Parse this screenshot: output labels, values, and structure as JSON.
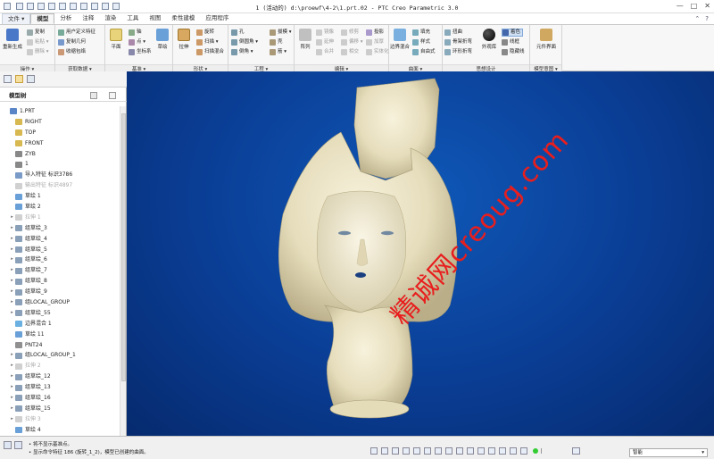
{
  "window": {
    "title": "1 (活动的) d:\\proewf\\4-2\\1.prt.02 - PTC Creo Parametric 3.0",
    "minimize": "—",
    "maximize": "□",
    "close": "✕"
  },
  "menu_tabs": [
    {
      "label": "文件 ▾",
      "active": false
    },
    {
      "label": "模型",
      "active": true
    },
    {
      "label": "分析",
      "active": false
    },
    {
      "label": "注释",
      "active": false
    },
    {
      "label": "渲染",
      "active": false
    },
    {
      "label": "工具",
      "active": false
    },
    {
      "label": "视图",
      "active": false
    },
    {
      "label": "柔性建模",
      "active": false
    },
    {
      "label": "应用程序",
      "active": false
    }
  ],
  "ribbon": {
    "operations": {
      "label": "操作 ▾",
      "regenerate": "重新生成",
      "copy": "复制",
      "paste": "粘贴 ▾",
      "delete": "删除 ▾"
    },
    "get_data": {
      "label": "获取数据 ▾",
      "udf": "用户定义特征",
      "copy_geom": "复制几何",
      "shrinkwrap": "收缩包络"
    },
    "datum": {
      "label": "基准 ▾",
      "plane": "平面",
      "axis": "轴",
      "point": "点 ▾",
      "csys": "坐标系",
      "sketch": "草绘"
    },
    "shapes": {
      "label": "形状 ▾",
      "extrude": "拉伸",
      "revolve": "旋转",
      "sweep": "扫描 ▾",
      "swept_blend": "扫描混合"
    },
    "engineering": {
      "label": "工程 ▾",
      "hole": "孔",
      "round": "倒圆角 ▾",
      "chamfer": "倒角 ▾",
      "draft": "拔模 ▾",
      "shell": "壳",
      "rib": "筋 ▾"
    },
    "editing": {
      "label": "编辑 ▾",
      "pattern": "阵列",
      "mirror": "镜像",
      "extend": "延伸",
      "trim": "修剪",
      "offset": "偏移 ▾",
      "merge": "合并",
      "intersect": "相交",
      "project": "投影",
      "thicken": "加厚",
      "solidify": "实体化"
    },
    "surfaces": {
      "label": "曲面 ▾",
      "boundary_blend": "边界混合",
      "fill": "填充",
      "style": "样式",
      "freestyle": "自由式"
    },
    "model_intent": {
      "label": "模型意图 ▾",
      "component_interface": "元件界面"
    },
    "design": {
      "label": "思想设计",
      "warp": "扭曲",
      "spinal_bend": "骨架折弯",
      "toroidal_bend": "环形折弯",
      "appearance": "外观库",
      "shading": "着色",
      "wireframe": "线框",
      "hidden_line": "隐藏线"
    }
  },
  "model_tree": {
    "header": "模型树",
    "items": [
      {
        "label": "1.PRT",
        "indent": 0,
        "expand": "",
        "icon": "part-icon",
        "dim": false
      },
      {
        "label": "RIGHT",
        "indent": 1,
        "expand": "",
        "icon": "datum-plane-icon",
        "dim": false
      },
      {
        "label": "TOP",
        "indent": 1,
        "expand": "",
        "icon": "datum-plane-icon",
        "dim": false
      },
      {
        "label": "FRONT",
        "indent": 1,
        "expand": "",
        "icon": "datum-plane-icon",
        "dim": false
      },
      {
        "label": "ZYB",
        "indent": 1,
        "expand": "",
        "icon": "csys-icon",
        "dim": false
      },
      {
        "label": "1",
        "indent": 1,
        "expand": "",
        "icon": "csys-icon",
        "dim": false
      },
      {
        "label": "导入特征 标识3786",
        "indent": 1,
        "expand": "",
        "icon": "import-icon",
        "dim": false
      },
      {
        "label": "输出特征 标识4897",
        "indent": 1,
        "expand": "",
        "icon": "import-icon",
        "dim": true
      },
      {
        "label": "草绘 1",
        "indent": 1,
        "expand": "",
        "icon": "sketch-icon",
        "dim": false
      },
      {
        "label": "草绘 2",
        "indent": 1,
        "expand": "",
        "icon": "sketch-icon",
        "dim": false
      },
      {
        "label": "拉伸 1",
        "indent": 1,
        "expand": "▸",
        "icon": "extrude-icon",
        "dim": true
      },
      {
        "label": "组草绘_3",
        "indent": 1,
        "expand": "▸",
        "icon": "group-icon",
        "dim": false
      },
      {
        "label": "组草绘_4",
        "indent": 1,
        "expand": "▸",
        "icon": "group-icon",
        "dim": false
      },
      {
        "label": "组草绘_5",
        "indent": 1,
        "expand": "▸",
        "icon": "group-icon",
        "dim": false
      },
      {
        "label": "组草绘_6",
        "indent": 1,
        "expand": "▸",
        "icon": "group-icon",
        "dim": false
      },
      {
        "label": "组草绘_7",
        "indent": 1,
        "expand": "▸",
        "icon": "group-icon",
        "dim": false
      },
      {
        "label": "组草绘_8",
        "indent": 1,
        "expand": "▸",
        "icon": "group-icon",
        "dim": false
      },
      {
        "label": "组草绘_9",
        "indent": 1,
        "expand": "▸",
        "icon": "group-icon",
        "dim": false
      },
      {
        "label": "组LOCAL_GROUP",
        "indent": 1,
        "expand": "▸",
        "icon": "group-icon",
        "dim": false
      },
      {
        "label": "组草绘_55",
        "indent": 1,
        "expand": "▸",
        "icon": "group-icon",
        "dim": false
      },
      {
        "label": "边界混合 1",
        "indent": 1,
        "expand": "",
        "icon": "boundary-blend-icon",
        "dim": false
      },
      {
        "label": "草绘 11",
        "indent": 1,
        "expand": "",
        "icon": "sketch-icon",
        "dim": false
      },
      {
        "label": "PNT24",
        "indent": 1,
        "expand": "",
        "icon": "datum-point-icon",
        "dim": false
      },
      {
        "label": "组LOCAL_GROUP_1",
        "indent": 1,
        "expand": "▸",
        "icon": "group-icon",
        "dim": false
      },
      {
        "label": "拉伸 2",
        "indent": 1,
        "expand": "▸",
        "icon": "extrude-icon",
        "dim": true
      },
      {
        "label": "组草绘_12",
        "indent": 1,
        "expand": "▸",
        "icon": "group-icon",
        "dim": false
      },
      {
        "label": "组草绘_13",
        "indent": 1,
        "expand": "▸",
        "icon": "group-icon",
        "dim": false
      },
      {
        "label": "组草绘_16",
        "indent": 1,
        "expand": "▸",
        "icon": "group-icon",
        "dim": false
      },
      {
        "label": "组草绘_15",
        "indent": 1,
        "expand": "▸",
        "icon": "group-icon",
        "dim": false
      },
      {
        "label": "拉伸 3",
        "indent": 1,
        "expand": "▸",
        "icon": "extrude-icon",
        "dim": true
      },
      {
        "label": "草绘 4",
        "indent": 1,
        "expand": "",
        "icon": "sketch-icon",
        "dim": false
      }
    ]
  },
  "viewport": {
    "watermark": "精诚网creoug.com",
    "background_color": "#0a3d94",
    "model_color": "#ece5c6"
  },
  "status": {
    "messages": [
      "• 将不显示基准点。",
      "• 显示命令特征 186 (旋转_1_2)，模型已创建的曲面。"
    ],
    "filter_value": "智能"
  },
  "colors": {
    "ribbon_bg": "#f7f7f7",
    "accent": "#0a3d94",
    "watermark": "#e81e1e"
  }
}
